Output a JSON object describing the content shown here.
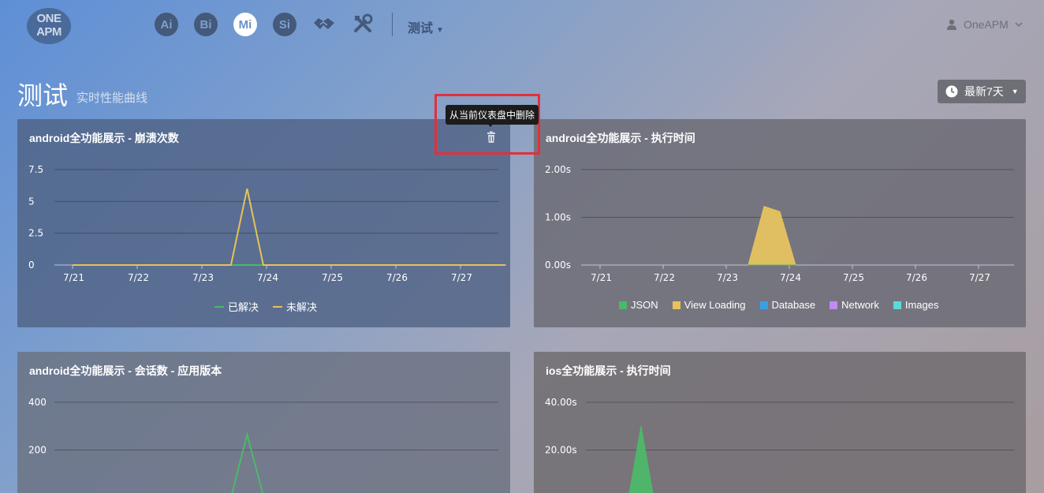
{
  "logo": {
    "line1": "ONE",
    "line2": "APM"
  },
  "nav": {
    "ai": "Ai",
    "bi": "Bi",
    "mi": "Mi",
    "si": "Si",
    "handshake_icon": "handshake-icon",
    "tools_icon": "tools-icon",
    "app_menu": "测试",
    "user": "OneAPM"
  },
  "page": {
    "title": "测试",
    "subtitle": "实时性能曲线",
    "time_range": "最新7天"
  },
  "tooltip": {
    "text": "从当前仪表盘中删除"
  },
  "colors": {
    "green": "#4cb86a",
    "yellow": "#e8c15a",
    "blue": "#3aa0e6",
    "purple": "#c08cf0",
    "cyan": "#5ed8d8"
  },
  "panels": [
    {
      "title": "android全功能展示 - 崩溃次数"
    },
    {
      "title": "android全功能展示 - 执行时间"
    },
    {
      "title": "android全功能展示 - 会话数 - 应用版本"
    },
    {
      "title": "ios全功能展示 - 执行时间"
    }
  ],
  "legend1": [
    "已解决",
    "未解决"
  ],
  "legend2": [
    "JSON",
    "View Loading",
    "Database",
    "Network",
    "Images"
  ],
  "chart_data": [
    {
      "type": "line",
      "title": "android全功能展示 - 崩溃次数",
      "x": [
        "7/21",
        "7/22",
        "7/23",
        "7/24",
        "7/25",
        "7/26",
        "7/27"
      ],
      "y_ticks": [
        "0",
        "2.5",
        "5",
        "7.5"
      ],
      "ylim": [
        0,
        7.5
      ],
      "series": [
        {
          "name": "已解决",
          "color": "#4cb86a",
          "points": [
            [
              0,
              0
            ],
            [
              6.7,
              0
            ]
          ]
        },
        {
          "name": "未解决",
          "color": "#e8c15a",
          "points": [
            [
              0,
              0
            ],
            [
              2.45,
              0
            ],
            [
              2.7,
              6
            ],
            [
              2.95,
              0
            ],
            [
              6.7,
              0
            ]
          ]
        }
      ]
    },
    {
      "type": "area",
      "title": "android全功能展示 - 执行时间",
      "x": [
        "7/21",
        "7/22",
        "7/23",
        "7/24",
        "7/25",
        "7/26",
        "7/27"
      ],
      "y_ticks": [
        "0.00s",
        "1.00s",
        "2.00s"
      ],
      "ylim": [
        0,
        2.0
      ],
      "series": [
        {
          "name": "Images",
          "color": "#5ed8d8",
          "points": [
            [
              2.35,
              0
            ],
            [
              2.6,
              0.05
            ],
            [
              2.85,
              0.1
            ],
            [
              3.1,
              0
            ]
          ]
        },
        {
          "name": "Network",
          "color": "#c08cf0",
          "points": [
            [
              2.35,
              0
            ],
            [
              2.6,
              1.05
            ],
            [
              2.85,
              0.9
            ],
            [
              3.1,
              0
            ]
          ]
        },
        {
          "name": "Database",
          "color": "#3aa0e6",
          "points": [
            [
              2.35,
              0
            ],
            [
              2.6,
              1.18
            ],
            [
              2.85,
              1.05
            ],
            [
              3.1,
              0
            ]
          ]
        },
        {
          "name": "View Loading",
          "color": "#e8c15a",
          "points": [
            [
              2.35,
              0
            ],
            [
              2.6,
              1.23
            ],
            [
              2.85,
              1.12
            ],
            [
              3.1,
              0
            ]
          ]
        },
        {
          "name": "JSON",
          "color": "#4cb86a",
          "points": [
            [
              2.35,
              0
            ],
            [
              2.6,
              0
            ],
            [
              2.85,
              0
            ],
            [
              3.1,
              0
            ]
          ]
        }
      ]
    },
    {
      "type": "line",
      "title": "android全功能展示 - 会话数 - 应用版本",
      "y_ticks": [
        "200",
        "400"
      ],
      "ylim": [
        0,
        400
      ],
      "series": [
        {
          "name": "",
          "color": "#4cb86a",
          "points": [
            [
              2.45,
              0
            ],
            [
              2.7,
              265
            ],
            [
              2.95,
              10
            ],
            [
              3.05,
              0
            ]
          ]
        }
      ]
    },
    {
      "type": "area",
      "title": "ios全功能展示 - 执行时间",
      "y_ticks": [
        "20.00s",
        "40.00s"
      ],
      "ylim": [
        0,
        40
      ],
      "series": [
        {
          "name": "",
          "color": "#4cb86a",
          "points": [
            [
              0.45,
              0
            ],
            [
              0.65,
              30
            ],
            [
              0.85,
              0
            ]
          ]
        }
      ]
    }
  ]
}
